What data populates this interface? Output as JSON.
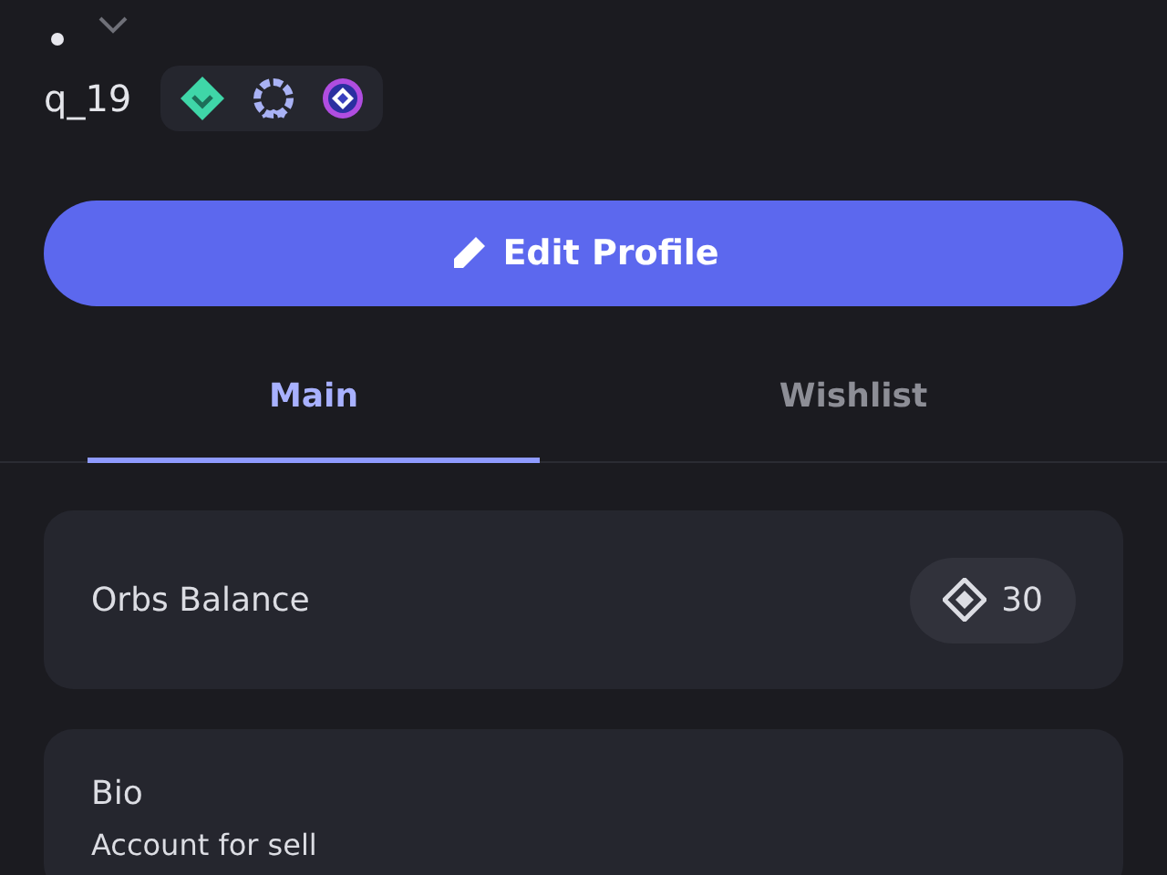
{
  "header": {
    "status_dot": true,
    "username": "q_19"
  },
  "badges": [
    {
      "kind": "diamond"
    },
    {
      "kind": "laurel"
    },
    {
      "kind": "orb"
    }
  ],
  "edit_button": {
    "label": "Edit Profile"
  },
  "tabs": [
    {
      "label": "Main",
      "selected": true
    },
    {
      "label": "Wishlist",
      "selected": false
    }
  ],
  "orbs_card": {
    "title": "Orbs Balance",
    "amount": "30"
  },
  "bio_card": {
    "title": "Bio",
    "text": "Account for sell"
  }
}
